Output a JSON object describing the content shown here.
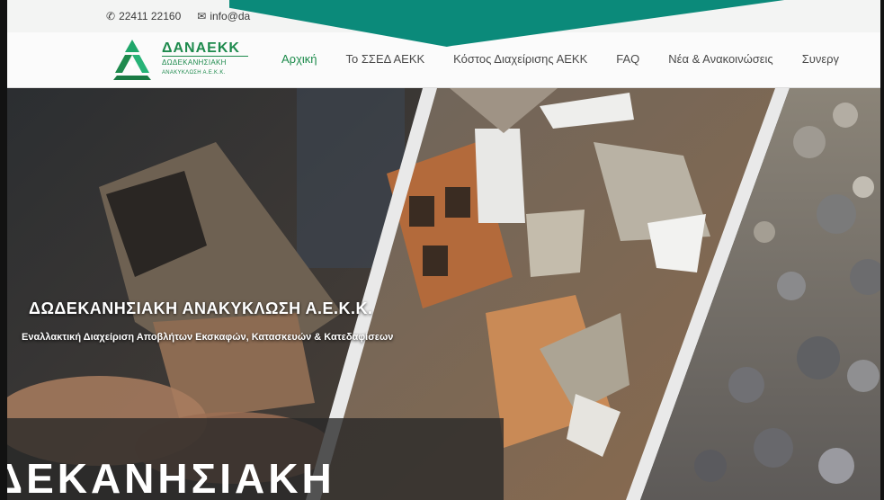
{
  "contact": {
    "phone": "22411 22160",
    "email": "info@da",
    "phone_icon": "phone-icon",
    "email_icon": "envelope-icon"
  },
  "brand": {
    "name": "ΔΑΝΑΕΚΚ",
    "sub1": "ΔΩΔΕΚΑΝΗΣΙΑΚΗ",
    "sub2": "ΑΝΑΚΥΚΛΩΣΗ Α.Ε.Κ.Κ.",
    "accent": "#1e8a4d",
    "teal": "#0b8a7a"
  },
  "nav": {
    "items": [
      {
        "label": "Αρχική",
        "active": true
      },
      {
        "label": "Το ΣΣΕΔ ΑΕΚΚ",
        "active": false
      },
      {
        "label": "Κόστος Διαχείρισης ΑΕΚΚ",
        "active": false
      },
      {
        "label": "FAQ",
        "active": false
      },
      {
        "label": "Νέα & Ανακοινώσεις",
        "active": false
      },
      {
        "label": "Συνεργ",
        "active": false
      }
    ]
  },
  "hero": {
    "title": "ΔΩΔΕΚΑΝΗΣΙΑΚΗ ΑΝΑΚΥΚΛΩΣΗ Α.Ε.Κ.Κ.",
    "subtitle": "Εναλλακτική Διαχείριση Αποβλήτων Εκσκαφών, Κατασκευών & Κατεδαφίσεων"
  },
  "bottom": {
    "heading": "ΔΕΚΑΝΗΣΙΑΚΗ"
  }
}
